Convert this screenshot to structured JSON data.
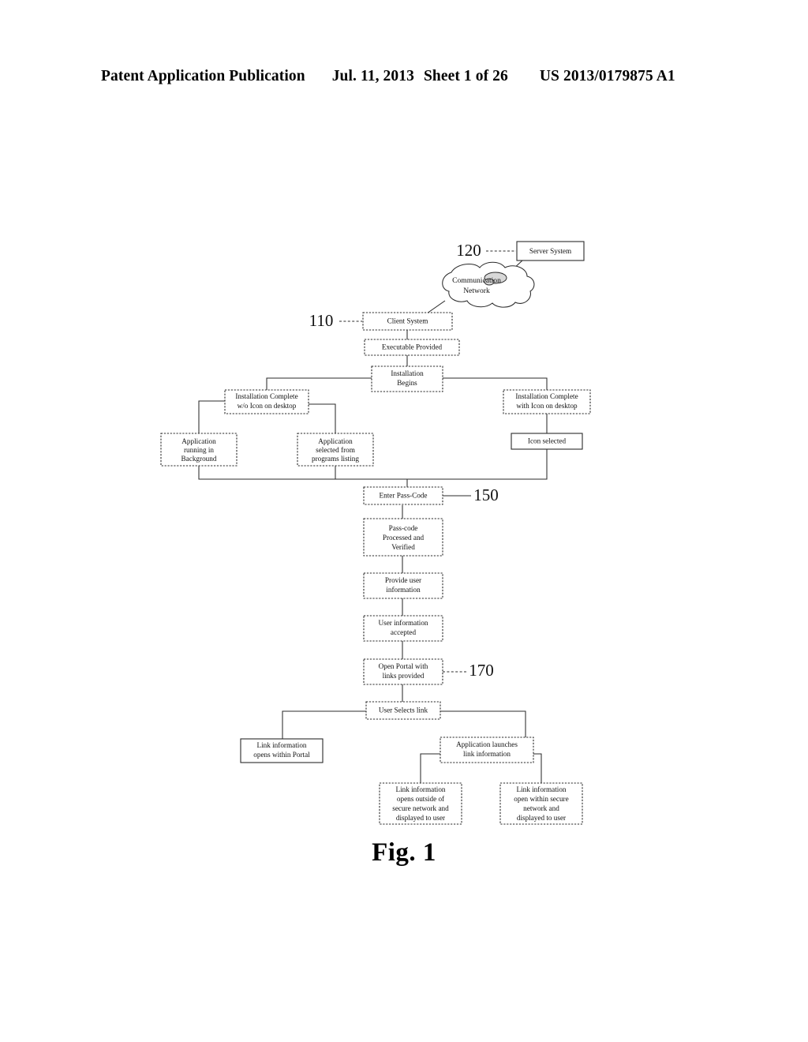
{
  "header": {
    "publication": "Patent Application Publication",
    "date": "Jul. 11, 2013",
    "sheet": "Sheet 1 of 26",
    "number": "US 2013/0179875 A1"
  },
  "figure": {
    "caption": "Fig. 1"
  },
  "diagram": {
    "reference_numerals": {
      "server": "120",
      "client": "110",
      "passcode": "150",
      "portal": "170"
    },
    "cloud": {
      "line1": "Communication",
      "line2": "Network"
    },
    "nodes": {
      "server_system": "Server System",
      "client_system": "Client System",
      "executable_provided": "Executable Provided",
      "installation_begins_l1": "Installation",
      "installation_begins_l2": "Begins",
      "install_no_icon_l1": "Installation Complete",
      "install_no_icon_l2": "w/o Icon on desktop",
      "install_with_icon_l1": "Installation Complete",
      "install_with_icon_l2": "with Icon on desktop",
      "app_background_l1": "Application",
      "app_background_l2": "running in",
      "app_background_l3": "Background",
      "app_programs_l1": "Application",
      "app_programs_l2": "selected from",
      "app_programs_l3": "programs listing",
      "icon_selected": "Icon selected",
      "enter_passcode": "Enter Pass-Code",
      "passcode_verified_l1": "Pass-code",
      "passcode_verified_l2": "Processed and",
      "passcode_verified_l3": "Verified",
      "provide_user_info_l1": "Provide user",
      "provide_user_info_l2": "information",
      "user_info_accepted_l1": "User information",
      "user_info_accepted_l2": "accepted",
      "open_portal_l1": "Open Portal with",
      "open_portal_l2": "links provided",
      "user_selects_link": "User Selects link",
      "link_within_portal_l1": "Link information",
      "link_within_portal_l2": "opens within Portal",
      "app_launches_l1": "Application launches",
      "app_launches_l2": "link information",
      "link_outside_l1": "Link information",
      "link_outside_l2": "opens outside of",
      "link_outside_l3": "secure network and",
      "link_outside_l4": "displayed to user",
      "link_inside_l1": "Link information",
      "link_inside_l2": "open within secure",
      "link_inside_l3": "network and",
      "link_inside_l4": "displayed to user"
    }
  }
}
